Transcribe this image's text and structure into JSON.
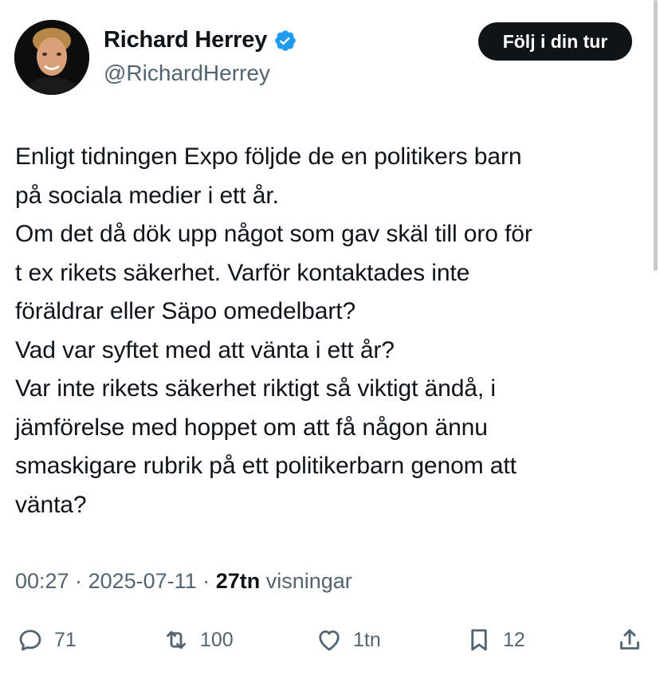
{
  "header": {
    "display_name": "Richard Herrey",
    "handle": "@RichardHerrey",
    "follow_label": "Följ i din tur",
    "verified_color": "#1d9bf0"
  },
  "tweet": {
    "lines": [
      "Enligt tidningen Expo följde de en politikers barn",
      "på sociala medier i ett år.",
      "Om det då dök upp något som gav skäl till oro för",
      "t ex rikets säkerhet. Varför kontaktades inte",
      "föräldrar eller Säpo omedelbart?",
      "Vad var syftet med att vänta i ett år?",
      "Var inte rikets säkerhet riktigt så viktigt ändå, i",
      "jämförelse med hoppet om att få någon ännu",
      "smaskigare rubrik på ett politikerbarn genom att",
      "vänta?"
    ]
  },
  "meta": {
    "time": "00:27",
    "separator": " · ",
    "date": "2025-07-11",
    "views_count": "27tn",
    "views_label": "visningar"
  },
  "actions": {
    "replies": "71",
    "reposts": "100",
    "likes": "1tn",
    "bookmarks": "12",
    "icons": [
      "reply-icon",
      "repost-icon",
      "like-icon",
      "bookmark-icon",
      "share-icon"
    ],
    "icon_color": "#536471"
  }
}
